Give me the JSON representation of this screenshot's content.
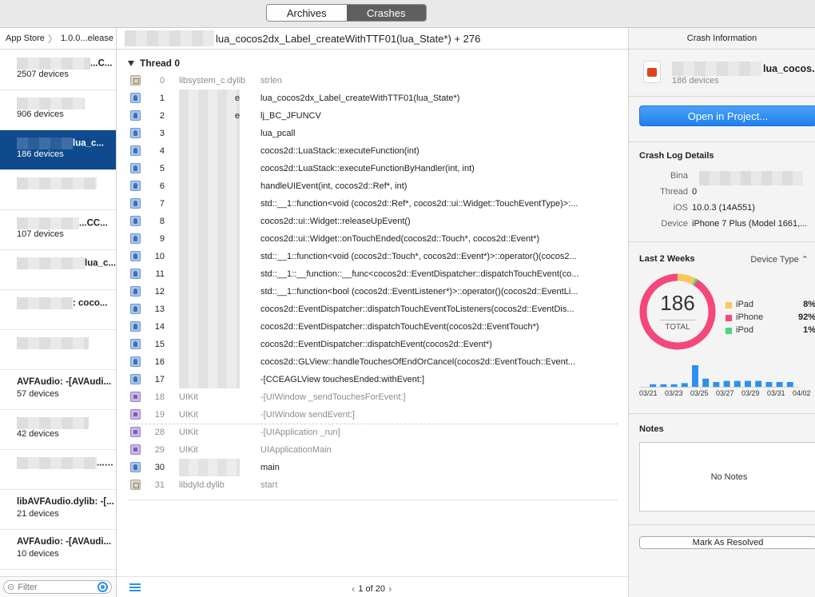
{
  "toolbar": {
    "archives_label": "Archives",
    "crashes_label": "Crashes"
  },
  "sidebar": {
    "breadcrumb": [
      "App Store",
      "1.0.0...elease"
    ],
    "items": [
      {
        "title": "...C...",
        "devices": "2507 devices",
        "selected": false
      },
      {
        "title": "",
        "devices": "906 devices",
        "selected": false
      },
      {
        "title": "lua_c...",
        "devices": "186 devices",
        "selected": true
      },
      {
        "title": "",
        "devices": "",
        "selected": false
      },
      {
        "title": "...CC...",
        "devices": "107 devices",
        "selected": false
      },
      {
        "title": "lua_c...",
        "devices": "",
        "selected": false
      },
      {
        "title": ": coco...",
        "devices": "",
        "selected": false
      },
      {
        "title": "",
        "devices": "",
        "selected": false
      },
      {
        "title": "AVFAudio: -[AVAudi...",
        "devices": "57 devices",
        "selected": false
      },
      {
        "title": "",
        "devices": "42 devices",
        "selected": false
      },
      {
        "title": "...co...",
        "devices": "",
        "selected": false
      },
      {
        "title": "libAVFAudio.dylib: -[...",
        "devices": "21 devices",
        "selected": false
      },
      {
        "title": "AVFAudio: -[AVAudi...",
        "devices": "10 devices",
        "selected": false
      }
    ],
    "filter_placeholder": "Filter"
  },
  "center": {
    "header": "lua_cocos2dx_Label_createWithTTF01(lua_State*) + 276",
    "thread": "Thread 0",
    "frames": [
      {
        "num": "0",
        "lib": "libsystem_c.dylib",
        "sym": "strlen",
        "kind": "sys",
        "dim": true
      },
      {
        "num": "1",
        "lib": "e",
        "sym": "lua_cocos2dx_Label_createWithTTF01(lua_State*)",
        "kind": "user",
        "dim": false
      },
      {
        "num": "2",
        "lib": "e",
        "sym": "lj_BC_JFUNCV",
        "kind": "user",
        "dim": false
      },
      {
        "num": "3",
        "lib": "",
        "sym": "lua_pcall",
        "kind": "user",
        "dim": false
      },
      {
        "num": "4",
        "lib": "",
        "sym": "cocos2d::LuaStack::executeFunction(int)",
        "kind": "user",
        "dim": false
      },
      {
        "num": "5",
        "lib": "",
        "sym": "cocos2d::LuaStack::executeFunctionByHandler(int, int)",
        "kind": "user",
        "dim": false
      },
      {
        "num": "6",
        "lib": "",
        "sym": "handleUIEvent(int, cocos2d::Ref*, int)",
        "kind": "user",
        "dim": false
      },
      {
        "num": "7",
        "lib": "",
        "sym": "std::__1::function<void (cocos2d::Ref*, cocos2d::ui::Widget::TouchEventType)>:...",
        "kind": "user",
        "dim": false
      },
      {
        "num": "8",
        "lib": "",
        "sym": "cocos2d::ui::Widget::releaseUpEvent()",
        "kind": "user",
        "dim": false
      },
      {
        "num": "9",
        "lib": "",
        "sym": "cocos2d::ui::Widget::onTouchEnded(cocos2d::Touch*, cocos2d::Event*)",
        "kind": "user",
        "dim": false
      },
      {
        "num": "10",
        "lib": "",
        "sym": "std::__1::function<void (cocos2d::Touch*, cocos2d::Event*)>::operator()(cocos2...",
        "kind": "user",
        "dim": false
      },
      {
        "num": "11",
        "lib": "",
        "sym": "std::__1::__function::__func<cocos2d::EventDispatcher::dispatchTouchEvent(co...",
        "kind": "user",
        "dim": false
      },
      {
        "num": "12",
        "lib": "",
        "sym": "std::__1::function<bool (cocos2d::EventListener*)>::operator()(cocos2d::EventLi...",
        "kind": "user",
        "dim": false
      },
      {
        "num": "13",
        "lib": "",
        "sym": "cocos2d::EventDispatcher::dispatchTouchEventToListeners(cocos2d::EventDis...",
        "kind": "user",
        "dim": false
      },
      {
        "num": "14",
        "lib": "",
        "sym": "cocos2d::EventDispatcher::dispatchTouchEvent(cocos2d::EventTouch*)",
        "kind": "user",
        "dim": false
      },
      {
        "num": "15",
        "lib": "",
        "sym": "cocos2d::EventDispatcher::dispatchEvent(cocos2d::Event*)",
        "kind": "user",
        "dim": false
      },
      {
        "num": "16",
        "lib": "",
        "sym": "cocos2d::GLView::handleTouchesOfEndOrCancel(cocos2d::EventTouch::Event...",
        "kind": "user",
        "dim": false
      },
      {
        "num": "17",
        "lib": "",
        "sym": "-[CCEAGLView touchesEnded:withEvent:]",
        "kind": "user",
        "dim": false
      },
      {
        "num": "18",
        "lib": "UIKit",
        "sym": "-[UIWindow _sendTouchesForEvent:]",
        "kind": "kit",
        "dim": true
      },
      {
        "num": "19",
        "lib": "UIKit",
        "sym": "-[UIWindow sendEvent:]",
        "kind": "kit",
        "dim": true
      },
      {
        "num": "28",
        "lib": "UIKit",
        "sym": "-[UIApplication _run]",
        "kind": "kit",
        "dim": true
      },
      {
        "num": "29",
        "lib": "UIKit",
        "sym": "UIApplicationMain",
        "kind": "kit",
        "dim": true
      },
      {
        "num": "30",
        "lib": "",
        "sym": "main",
        "kind": "user",
        "dim": false
      },
      {
        "num": "31",
        "lib": "libdyld.dylib",
        "sym": "start",
        "kind": "sys",
        "dim": true
      }
    ],
    "pager": "1 of 20"
  },
  "info": {
    "header": "Crash Information",
    "app_name": "lua_cocos...",
    "app_devices": "186 devices",
    "open_label": "Open in Project...",
    "details_title": "Crash Log Details",
    "binary_key": "Bina",
    "thread_key": "Thread",
    "thread_val": "0",
    "ios_key": "iOS",
    "ios_val": "10.0.3 (14A551)",
    "device_key": "Device",
    "device_val": "iPhone 7 Plus (Model 1661,...",
    "weeks_title": "Last 2 Weeks",
    "device_type_label": "Device Type",
    "total": "186",
    "total_label": "TOTAL",
    "legend": [
      {
        "name": "iPad",
        "pct": "8%",
        "value": 8,
        "color": "#f9c75a"
      },
      {
        "name": "iPhone",
        "pct": "92%",
        "value": 92,
        "color": "#f4487a"
      },
      {
        "name": "iPod",
        "pct": "1%",
        "value": 1,
        "color": "#4fd27d"
      }
    ],
    "histogram": [
      0,
      0.15,
      0.15,
      0.15,
      0.2,
      1.0,
      0.4,
      0.25,
      0.3,
      0.3,
      0.3,
      0.3,
      0.25,
      0.25,
      0.25
    ],
    "dates": [
      "03/21",
      "03/23",
      "03/25",
      "03/27",
      "03/29",
      "03/31",
      "04/02"
    ],
    "notes_title": "Notes",
    "notes_empty": "No Notes",
    "resolve_label": "Mark As Resolved"
  },
  "colors": {
    "accent": "#1e82ee",
    "selection": "#0e4a8d",
    "bar": "#2d8ff0"
  }
}
